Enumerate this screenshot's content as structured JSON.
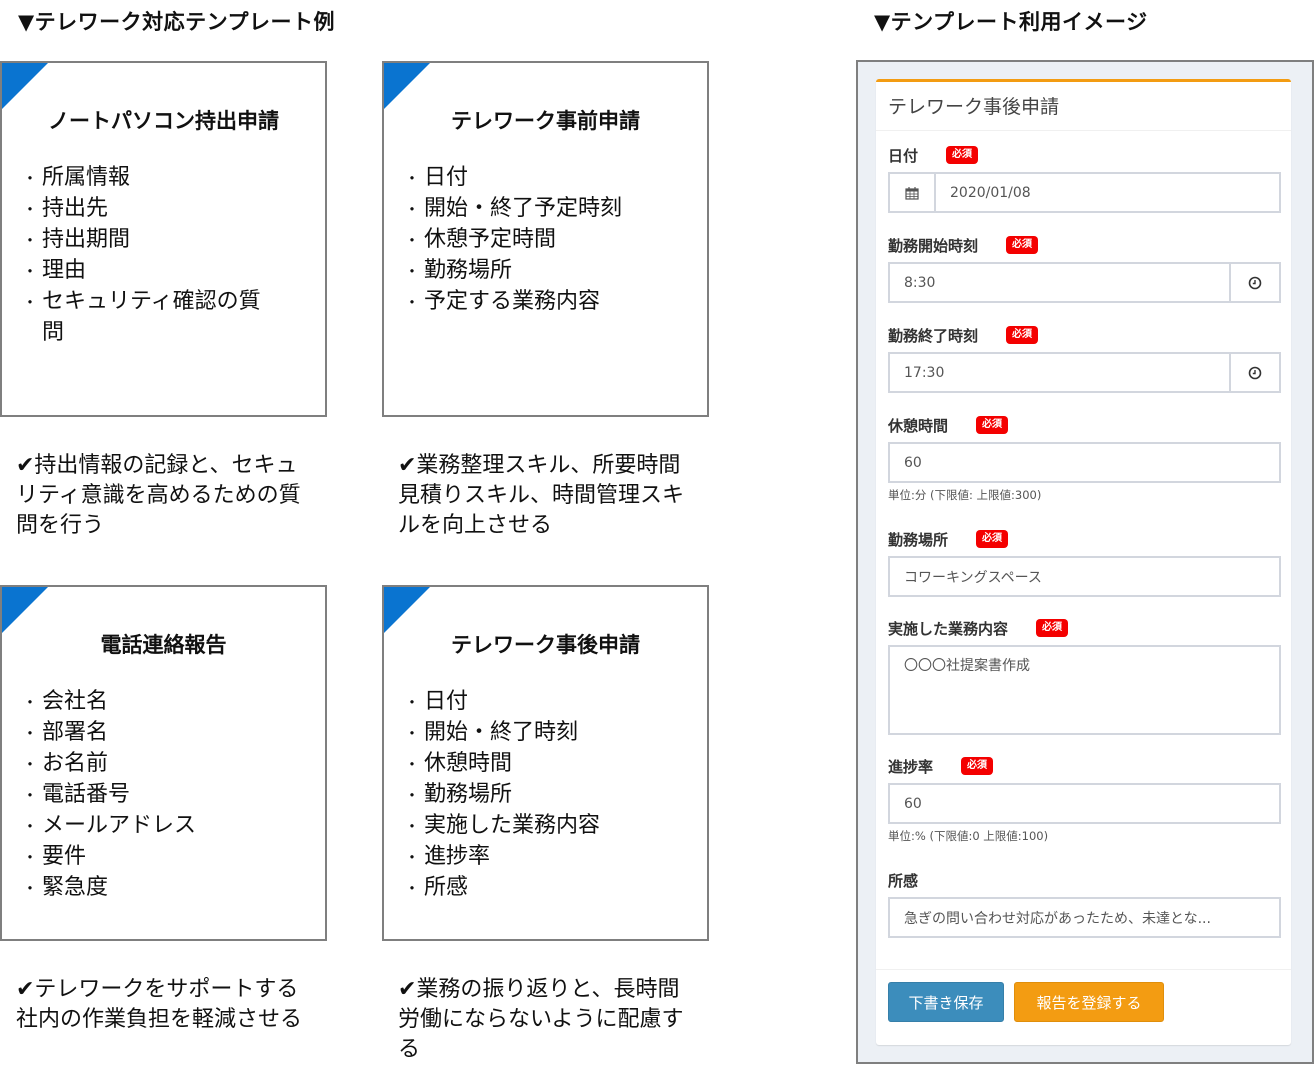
{
  "left_section": {
    "title": "▼テレワーク対応テンプレート例",
    "cards": [
      {
        "title": "ノートパソコン持出申請",
        "items": [
          "所属情報",
          "持出先",
          "持出期間",
          "理由",
          "セキュリティ確認の質問"
        ],
        "description": "✔持出情報の記録と、セキュリティ意識を高めるための質問を行う"
      },
      {
        "title": "テレワーク事前申請",
        "items": [
          "日付",
          "開始・終了予定時刻",
          "休憩予定時間",
          "勤務場所",
          "予定する業務内容"
        ],
        "description": "✔業務整理スキル、所要時間見積りスキル、時間管理スキルを向上させる"
      },
      {
        "title": "電話連絡報告",
        "items": [
          "会社名",
          "部署名",
          "お名前",
          "電話番号",
          "メールアドレス",
          "要件",
          "緊急度"
        ],
        "description": "✔テレワークをサポートする社内の作業負担を軽減させる"
      },
      {
        "title": "テレワーク事後申請",
        "items": [
          "日付",
          "開始・終了時刻",
          "休憩時間",
          "勤務場所",
          "実施した業務内容",
          "進捗率",
          "所感"
        ],
        "description": "✔業務の振り返りと、長時間労働にならないように配慮する"
      }
    ]
  },
  "right_section": {
    "title": "▼テンプレート利用イメージ",
    "form": {
      "header": "テレワーク事後申請",
      "required_badge": "必須",
      "fields": {
        "date": {
          "label": "日付",
          "value": "2020/01/08",
          "icon": "calendar-icon"
        },
        "start_time": {
          "label": "勤務開始時刻",
          "value": "8:30",
          "icon": "clock-icon"
        },
        "end_time": {
          "label": "勤務終了時刻",
          "value": "17:30",
          "icon": "clock-icon"
        },
        "break_time": {
          "label": "休憩時間",
          "value": "60",
          "help": "単位:分 (下限値:  上限値:300)"
        },
        "place": {
          "label": "勤務場所",
          "value": "コワーキングスペース"
        },
        "content": {
          "label": "実施した業務内容",
          "value": "〇〇〇社提案書作成"
        },
        "progress": {
          "label": "進捗率",
          "value": "60",
          "help": "単位:% (下限値:0  上限値:100)"
        },
        "impression": {
          "label": "所感",
          "value": "急ぎの問い合わせ対応があったため、未達とな..."
        }
      },
      "buttons": {
        "draft": "下書き保存",
        "submit": "報告を登録する"
      }
    }
  },
  "colors": {
    "corner_accent": "#0a74d0",
    "panel_top_border": "#f39c12",
    "required_badge": "#f40000",
    "draft_button": "#3c8dbc",
    "submit_button": "#f39c12"
  }
}
